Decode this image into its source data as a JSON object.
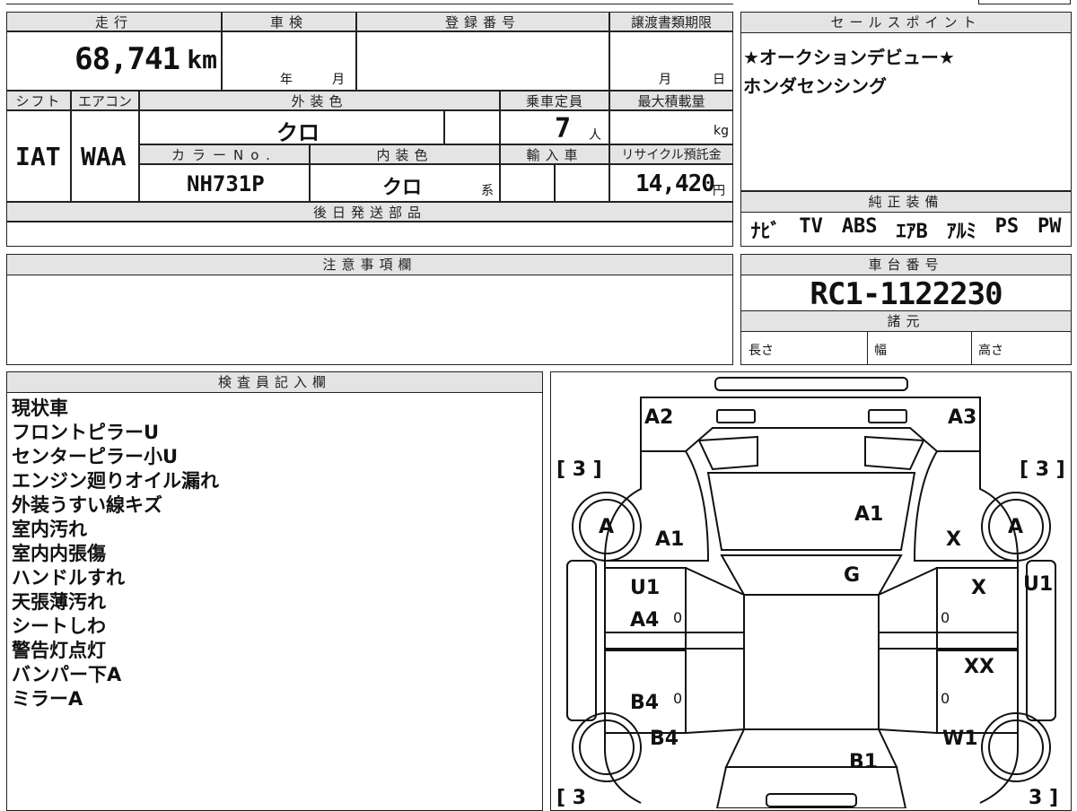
{
  "headers": {
    "mileage": "走行",
    "shaken": "車検",
    "registration": "登録番号",
    "transfer_deadline": "譲渡書類期限",
    "shift": "シフト",
    "aircon": "エアコン",
    "exterior_color": "外装色",
    "capacity": "乗車定員",
    "max_load": "最大積載量",
    "color_no": "カラーNo.",
    "interior_color": "内装色",
    "import_car": "輸入車",
    "recycle_fee": "リサイクル預託金",
    "later_parts": "後日発送部品",
    "notes": "注意事項欄",
    "sales_points": "セールスポイント",
    "genuine_equipment": "純正装備",
    "chassis_no": "車台番号",
    "specs": "諸元",
    "inspector": "検査員記入欄"
  },
  "values": {
    "mileage": "68,741",
    "mileage_unit": "km",
    "year_label": "年",
    "month_label": "月",
    "deadline_month": "月",
    "deadline_day": "日",
    "shift": "IAT",
    "aircon": "WAA",
    "exterior_color": "クロ",
    "capacity": "7",
    "capacity_unit": "人",
    "max_load_unit": "kg",
    "color_no": "NH731P",
    "interior_color": "クロ",
    "interior_suffix": "系",
    "recycle_fee": "14,420",
    "recycle_unit": "円",
    "chassis_no": "RC1-1122230",
    "length_label": "長さ",
    "width_label": "幅",
    "height_label": "高さ"
  },
  "sales_points": [
    "★オークションデビュー★",
    "ホンダセンシング"
  ],
  "equipment": [
    "ﾅﾋﾞ",
    "TV",
    "ABS",
    "ｴｱB",
    "ｱﾙﾐ",
    "PS",
    "PW"
  ],
  "inspector_notes": [
    "現状車",
    "フロントピラーU",
    "センターピラー小U",
    "エンジン廻りオイル漏れ",
    "外装うすい線キズ",
    "室内汚れ",
    "室内内張傷",
    "ハンドルすれ",
    "天張薄汚れ",
    "シートしわ",
    "警告灯点灯",
    "バンパー下A",
    "ミラーA"
  ],
  "diagram": {
    "tire_left_top": "[ 3 ]",
    "tire_right_top": "[ 3 ]",
    "tire_left_bottom": "[ 3",
    "tire_right_bottom": "3 ]",
    "a2": "A2",
    "a3": "A3",
    "wheel_front_left": "A",
    "wheel_front_right": "A",
    "a1_left": "A1",
    "a1_hood": "A1",
    "x_right_fender": "X",
    "g_glass": "G",
    "u1_left": "U1",
    "x_right_door": "X",
    "u1_right": "U1",
    "a4": "A4",
    "zero_1": "0",
    "zero_2": "0",
    "xx": "XX",
    "b4_door": "B4",
    "zero_3": "0",
    "zero_4": "0",
    "b4_rear": "B4",
    "w1": "W1",
    "b1": "B1"
  }
}
